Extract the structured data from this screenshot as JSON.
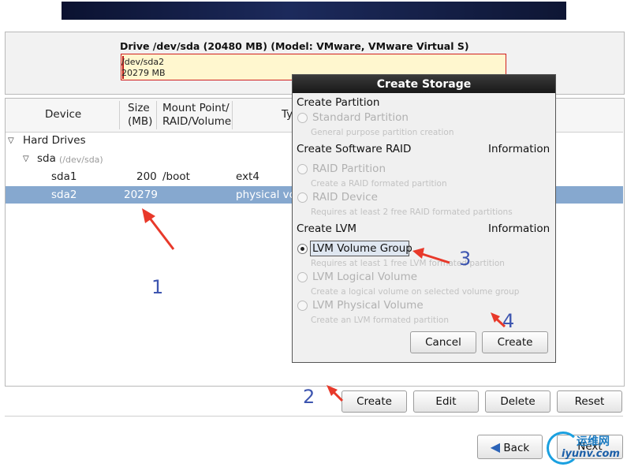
{
  "drive": {
    "title": "Drive /dev/sda (20480 MB) (Model: VMware, VMware Virtual S)",
    "partition_name": "/dev/sda2",
    "partition_size": "20279 MB"
  },
  "tree": {
    "columns": {
      "device": "Device",
      "size_1": "Size",
      "size_2": "(MB)",
      "mount_1": "Mount Point/",
      "mount_2": "RAID/Volume",
      "type": "Ty"
    },
    "hard_drives": "Hard Drives",
    "sda": {
      "name": "sda",
      "path": "(/dev/sda)"
    },
    "rows": [
      {
        "device": "sda1",
        "size": "200",
        "mount": "/boot",
        "type": "ext4"
      },
      {
        "device": "sda2",
        "size": "20279",
        "mount": "",
        "type": "physical vo"
      }
    ]
  },
  "dialog": {
    "title": "Create Storage",
    "partition_section": "Create Partition",
    "raid_section": "Create Software RAID",
    "raid_info": "Information",
    "lvm_section": "Create LVM",
    "lvm_info": "Information",
    "options": [
      {
        "label": "Standard Partition",
        "desc": "General purpose partition creation"
      },
      {
        "label": "RAID Partition",
        "desc": "Create a RAID formated partition"
      },
      {
        "label": "RAID Device",
        "desc": "Requires at least 2 free RAID formated partitions"
      },
      {
        "label": "LVM Volume Group",
        "desc": "Requires at least 1 free LVM formated partition"
      },
      {
        "label": "LVM Logical Volume",
        "desc": "Create a logical volume on selected volume group"
      },
      {
        "label": "LVM Physical Volume",
        "desc": "Create an LVM formated partition"
      }
    ],
    "cancel": "Cancel",
    "create": "Create"
  },
  "actions": {
    "create": "Create",
    "edit": "Edit",
    "delete": "Delete",
    "reset": "Reset"
  },
  "nav": {
    "back": "Back",
    "next": "Next"
  },
  "annotations": [
    "1",
    "2",
    "3",
    "4"
  ],
  "watermark": {
    "cn": "运维网",
    "url": "iyunv.com"
  },
  "colors": {
    "selection": "#86a8cf",
    "annotation": "#3e56b0",
    "arrow": "#e8392a"
  }
}
